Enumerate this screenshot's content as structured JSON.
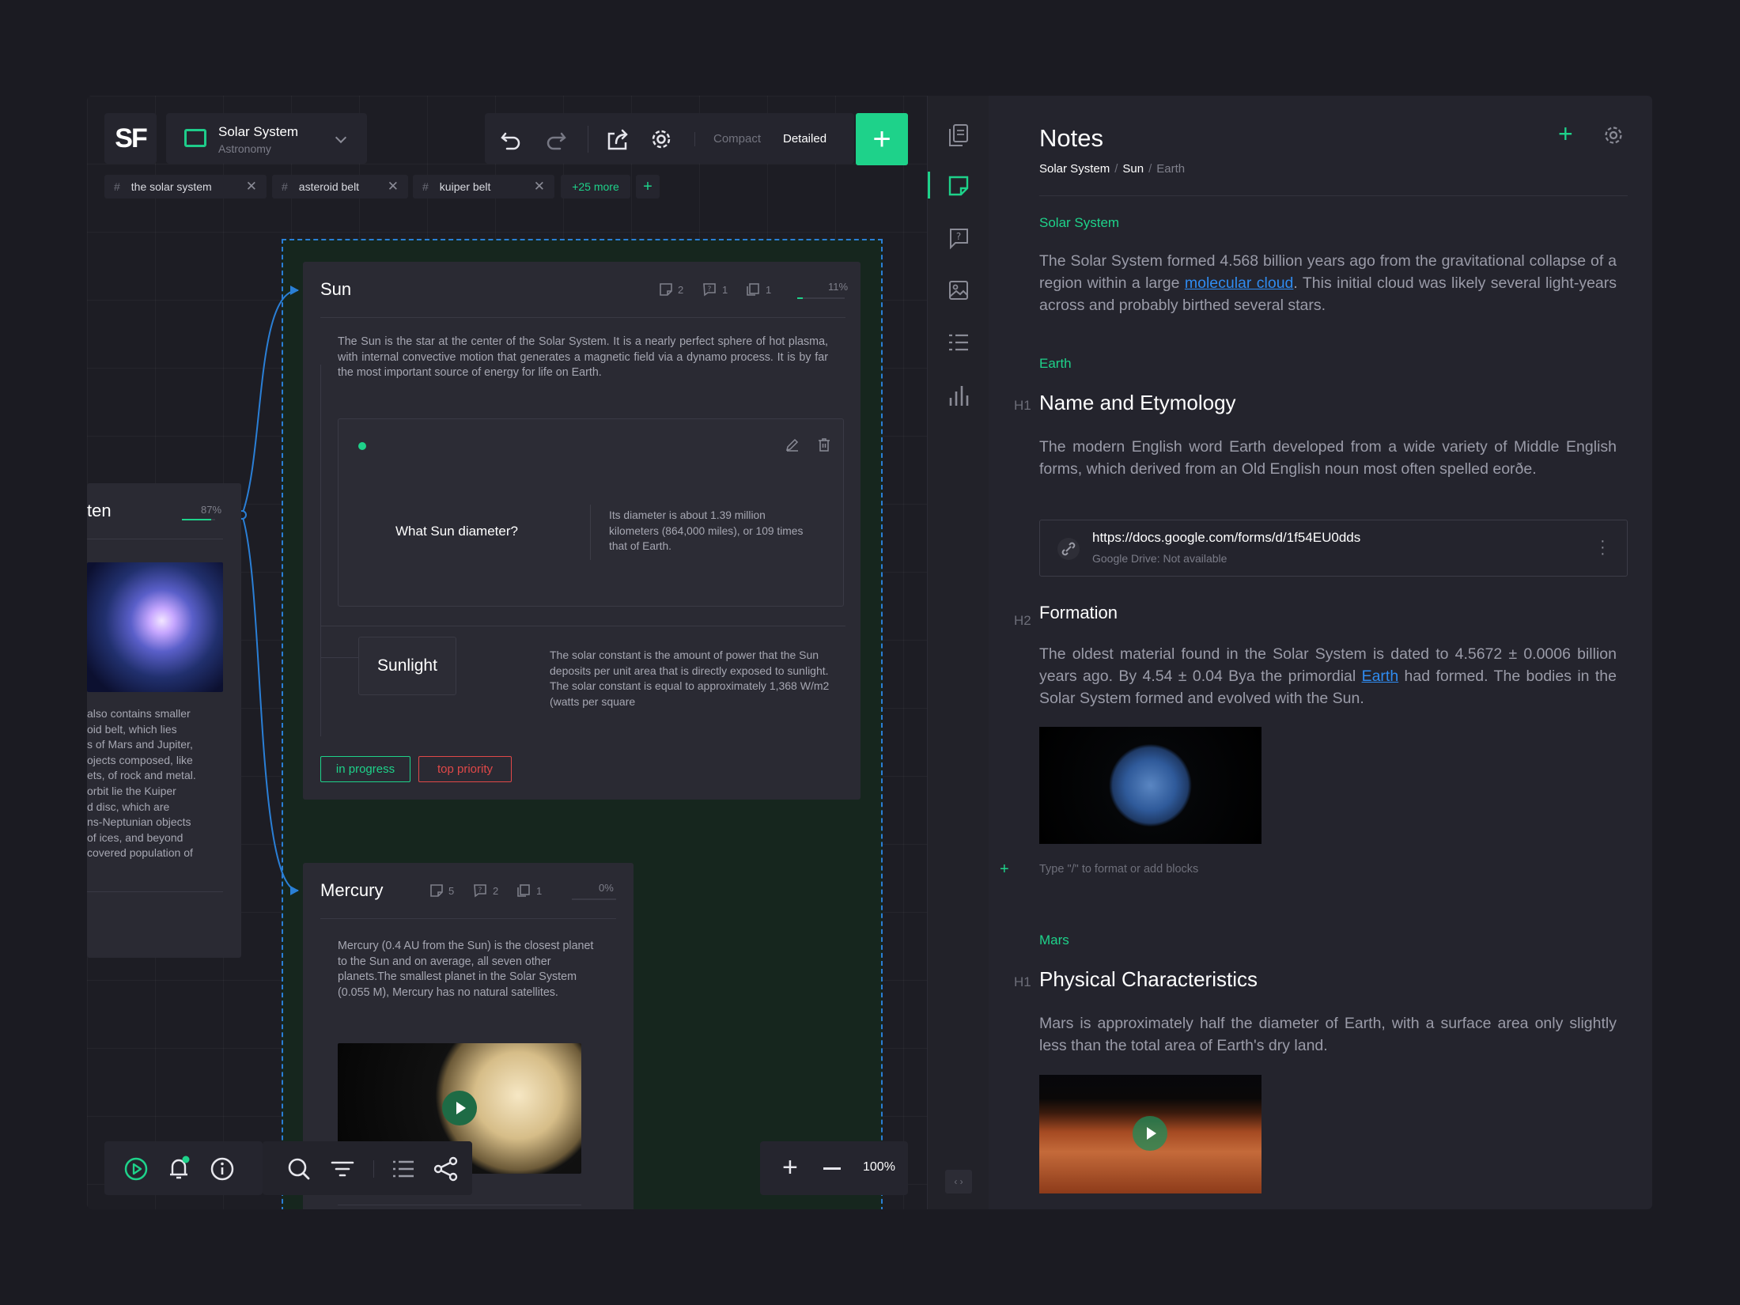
{
  "app": {
    "logo": "SF",
    "project_name": "Solar System",
    "project_category": "Astronomy"
  },
  "toolbar": {
    "mode_compact": "Compact",
    "mode_detailed": "Detailed",
    "add_label": "+"
  },
  "tags": {
    "items": [
      "the solar system",
      "asteroid belt",
      "kuiper belt"
    ],
    "more": "+25 more",
    "add": "+",
    "hash": "#",
    "remove": "✕"
  },
  "left_card": {
    "title_fragment": "ten",
    "percent": "87%",
    "progress": 0.87,
    "text_lines": [
      "also contains smaller",
      "oid belt, which lies",
      "s of Mars and Jupiter,",
      "ojects composed, like",
      "ets, of rock and metal.",
      "orbit lie the Kuiper",
      "d disc, which are",
      "ns-Neptunian objects",
      "of ices, and beyond",
      "covered population of"
    ]
  },
  "sun_card": {
    "title": "Sun",
    "notes_count": "2",
    "questions_count": "1",
    "docs_count": "1",
    "percent": "11%",
    "progress": 0.11,
    "description": "The Sun is the star at the center of the Solar System. It is a nearly perfect sphere of hot plasma, with internal convective motion that generates a magnetic field via a dynamo process. It is by far the most important source of energy for life on Earth.",
    "question": "What Sun diameter?",
    "answer": "Its diameter is about 1.39 million kilometers (864,000 miles), or 109 times that of Earth.",
    "sub_title": "Sunlight",
    "sub_text": "The solar constant is the amount of power that the Sun deposits per unit area that is directly exposed to sunlight. The solar constant is equal to approximately 1,368 W/m2 (watts per square",
    "badge_progress": "in progress",
    "badge_priority": "top priority"
  },
  "mercury_card": {
    "title": "Mercury",
    "notes_count": "5",
    "questions_count": "2",
    "docs_count": "1",
    "percent": "0%",
    "progress": 0,
    "description": "Mercury (0.4 AU from the Sun) is the closest planet to the Sun and on average, all seven other planets.The smallest planet in the Solar System (0.055 M), Mercury has no natural satellites."
  },
  "zoom": {
    "level": "100%"
  },
  "notes": {
    "title": "Notes",
    "breadcrumb": [
      "Solar System",
      "Sun",
      "Earth"
    ],
    "section_solar": "Solar System",
    "solar_text_1": "The Solar System formed 4.568 billion years ago from the gravitational collapse of a region within a large ",
    "solar_link": "molecular cloud",
    "solar_text_2": ". This initial cloud was likely several light-years across and probably birthed several stars.",
    "section_earth": "Earth",
    "h1_mark": "H1",
    "h_name": "Name and Etymology",
    "name_text": "The modern English word Earth developed from a wide variety of Middle English forms, which derived from an Old English noun most often spelled eorðe.",
    "link_url": "https://docs.google.com/forms/d/1f54EU0dds",
    "link_sub": "Google Drive: Not available",
    "h2_mark": "H2",
    "h_formation": "Formation",
    "formation_text_1": "The oldest material found in the Solar System is dated to 4.5672 ± 0.0006 billion years ago. By 4.54 ± 0.04 Bya the primordial ",
    "formation_link": "Earth",
    "formation_text_2": " had formed. The bodies in the Solar System formed and evolved with the Sun.",
    "type_hint": "Type \"/\" to format or add blocks",
    "section_mars": "Mars",
    "h_physical": "Physical Characteristics",
    "mars_text": "Mars is approximately half the diameter of Earth, with a surface area only slightly less than the total area of Earth's dry land."
  },
  "colors": {
    "accent": "#1ed28a",
    "link": "#2f8bf0",
    "danger": "#e04848",
    "connector": "#2a7fd6"
  }
}
